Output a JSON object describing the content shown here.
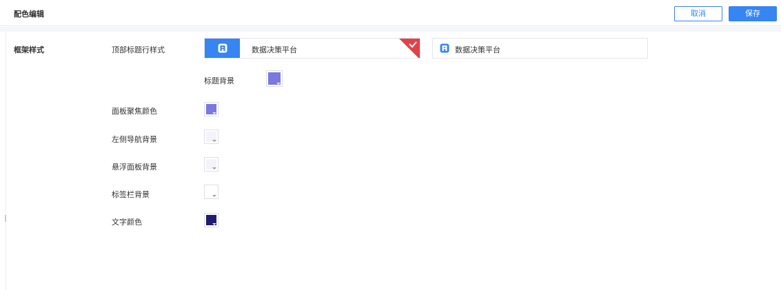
{
  "header": {
    "title": "配色编辑",
    "cancel_label": "取消",
    "save_label": "保存"
  },
  "section": {
    "title": "框架样式"
  },
  "title_row_style": {
    "label": "顶部标题行样式",
    "options": [
      {
        "text": "数据决策平台",
        "selected": true
      },
      {
        "text": "数据决策平台",
        "selected": false
      }
    ]
  },
  "colors": {
    "title_bg": {
      "label": "标题背景",
      "color": "#7b78de"
    },
    "panel_focus": {
      "label": "面板聚焦颜色",
      "color": "#7b78de"
    },
    "left_nav_bg": {
      "label": "左侧导航背景",
      "color": "#f3f3f9"
    },
    "float_panel_bg": {
      "label": "悬浮面板背景",
      "color": "#f3f3f9"
    },
    "tab_bar_bg": {
      "label": "标签栏背景",
      "color": "#ffffff"
    },
    "text_color": {
      "label": "文字颜色",
      "color": "#221c6e"
    }
  },
  "theme": {
    "accent": "#3685f2",
    "selected_mark": "#e2414a"
  }
}
